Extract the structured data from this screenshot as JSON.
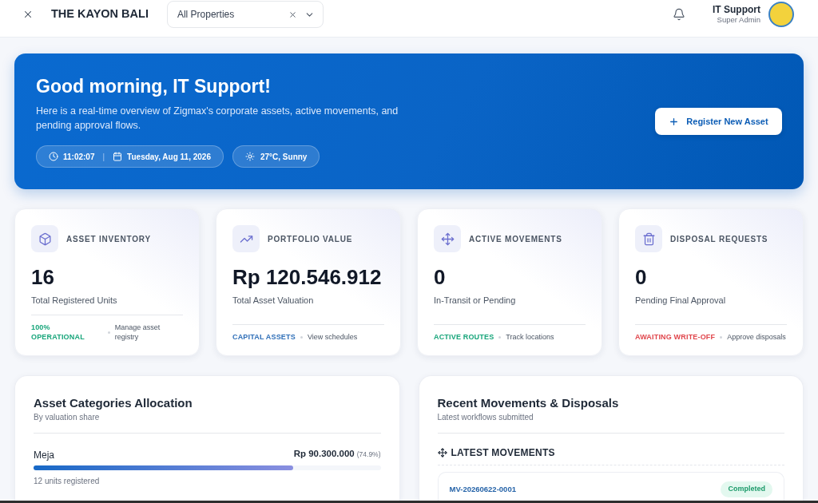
{
  "header": {
    "title": "THE KAYON BALI",
    "property_filter": {
      "value": "All Properties"
    },
    "user": {
      "name": "IT Support",
      "role": "Super Admin"
    }
  },
  "banner": {
    "greeting": "Good morning, IT Support!",
    "description": "Here is a real-time overview of Zigmax's corporate assets, active movements, and pending approval flows.",
    "time": "11:02:07",
    "separator": "|",
    "date": "Tuesday, Aug 11, 2026",
    "weather": "27°C, Sunny",
    "action": "Register New Asset"
  },
  "stats": [
    {
      "kind": "inventory",
      "label": "ASSET INVENTORY",
      "value": "16",
      "caption": "Total Registered Units",
      "status": "100% OPERATIONAL",
      "color": "#17a57a",
      "link": "Manage asset registry"
    },
    {
      "kind": "portfolio",
      "label": "PORTFOLIO VALUE",
      "value": "Rp 120.546.912",
      "caption": "Total Asset Valuation",
      "status": "CAPITAL ASSETS",
      "color": "#2f6fb8",
      "link": "View schedules"
    },
    {
      "kind": "movements",
      "label": "ACTIVE MOVEMENTS",
      "value": "0",
      "caption": "In-Transit or Pending",
      "status": "ACTIVE ROUTES",
      "color": "#17a57a",
      "link": "Track locations"
    },
    {
      "kind": "disposals",
      "label": "DISPOSAL REQUESTS",
      "value": "0",
      "caption": "Pending Final Approval",
      "status": "AWAITING WRITE-OFF",
      "color": "#e0454b",
      "link": "Approve disposals"
    }
  ],
  "allocation": {
    "title": "Asset Categories Allocation",
    "subtitle": "By valuation share",
    "categories": [
      {
        "name": "Meja",
        "amount": "Rp 90.300.000",
        "share": "(74.9%)",
        "level": 0.749,
        "units": "12 units registered"
      }
    ]
  },
  "recent": {
    "title": "Recent Movements & Disposals",
    "subtitle": "Latest workflows submitted",
    "section": "LATEST MOVEMENTS",
    "movements": [
      {
        "code": "MV-20260622-0001",
        "status": "Completed"
      }
    ]
  }
}
